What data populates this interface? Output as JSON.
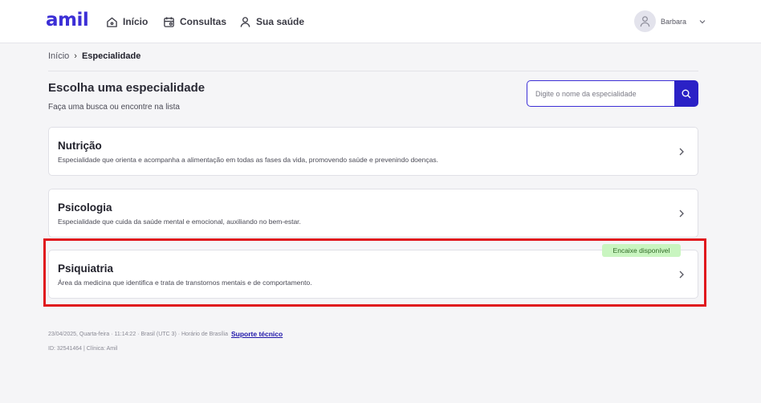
{
  "header": {
    "logo": "amil",
    "nav": [
      {
        "label": "Início",
        "icon": "home-icon"
      },
      {
        "label": "Consultas",
        "icon": "calendar-icon"
      },
      {
        "label": "Sua saúde",
        "icon": "person-icon"
      }
    ],
    "user": {
      "name": "Barbara",
      "icon": "user-avatar-icon"
    }
  },
  "breadcrumb": {
    "home": "Início",
    "separator": "›",
    "current": "Especialidade"
  },
  "page": {
    "title": "Escolha uma especialidade",
    "subtitle": "Faça uma busca ou encontre na lista"
  },
  "search": {
    "placeholder": "Digite o nome da especialidade",
    "value": ""
  },
  "specialties": [
    {
      "title": "Nutrição",
      "description": "Especialidade que orienta e acompanha a alimentação em todas as fases da vida, promovendo saúde e prevenindo doenças."
    },
    {
      "title": "Psicologia",
      "description": "Especialidade que cuida da saúde mental e emocional, auxiliando no bem-estar."
    },
    {
      "title": "Psiquiatria",
      "description": "Área da medicina que identifica e trata de transtornos mentais e de comportamento.",
      "badge": "Encaixe disponível"
    }
  ],
  "footer": {
    "datetime": "23/04/2025, Quarta-feira · 11:14:22 · Brasil (UTC 3) · Horário de Brasília",
    "support_link": "Suporte técnico",
    "ids": "ID: 32541464 | Clínica: Amil"
  },
  "colors": {
    "brand": "#3c2fd6",
    "search_button": "#2b21c6",
    "badge_bg": "#c9f5c0",
    "highlight": "#e0171d"
  }
}
